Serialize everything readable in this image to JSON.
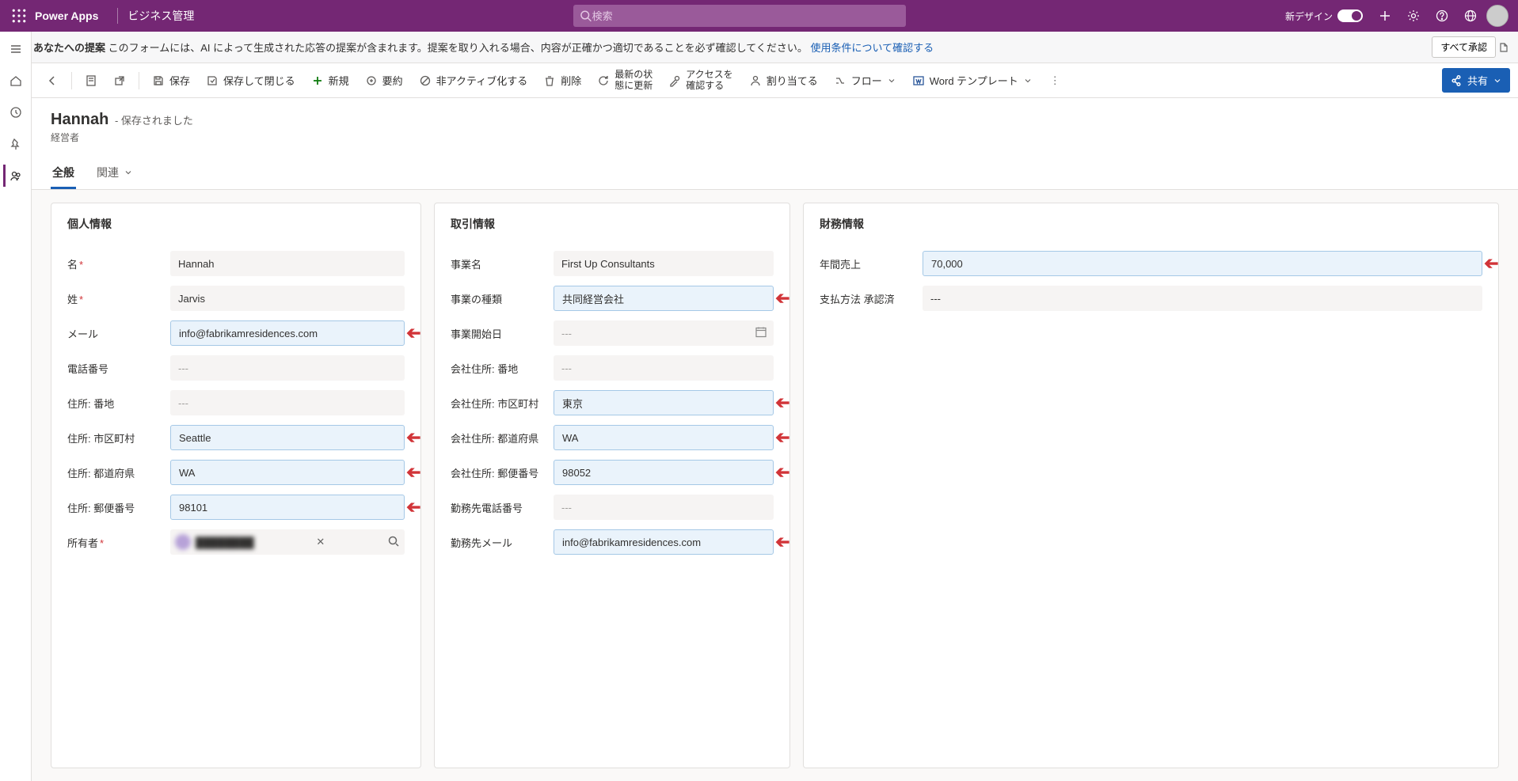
{
  "header": {
    "brand": "Power Apps",
    "app_name": "ビジネス管理",
    "search_placeholder": "検索",
    "new_design_label": "新デザイン"
  },
  "banner": {
    "prefix": "あなたへの提案",
    "text": "このフォームには、AI によって生成された応答の提案が含まれます。提案を取り入れる場合、内容が正確かつ適切であることを必ず確認してください。",
    "link": "使用条件について確認する",
    "approve_all": "すべて承認"
  },
  "commands": {
    "save": "保存",
    "save_close": "保存して閉じる",
    "new": "新規",
    "summary": "要約",
    "deactivate": "非アクティブ化する",
    "delete": "削除",
    "refresh_l1": "最新の状",
    "refresh_l2": "態に更新",
    "access_l1": "アクセスを",
    "access_l2": "確認する",
    "assign": "割り当てる",
    "flow": "フロー",
    "word_tpl": "Word テンプレート",
    "share": "共有"
  },
  "record": {
    "title": "Hannah",
    "status": "- 保存されました",
    "subtitle": "経営者",
    "tab_general": "全般",
    "tab_related": "関連"
  },
  "sections": {
    "personal": "個人情報",
    "business": "取引情報",
    "financial": "財務情報"
  },
  "fields": {
    "first_name_label": "名",
    "first_name": "Hannah",
    "last_name_label": "姓",
    "last_name": "Jarvis",
    "email_label": "メール",
    "email": "info@fabrikamresidences.com",
    "phone_label": "電話番号",
    "phone": "---",
    "addr_street_label": "住所: 番地",
    "addr_street": "---",
    "addr_city_label": "住所: 市区町村",
    "addr_city": "Seattle",
    "addr_state_label": "住所: 都道府県",
    "addr_state": "WA",
    "addr_zip_label": "住所: 郵便番号",
    "addr_zip": "98101",
    "owner_label": "所有者",
    "biz_name_label": "事業名",
    "biz_name": "First Up Consultants",
    "biz_type_label": "事業の種類",
    "biz_type": "共同経営会社",
    "biz_start_label": "事業開始日",
    "biz_start": "---",
    "co_addr_street_label": "会社住所: 番地",
    "co_addr_street": "---",
    "co_addr_city_label": "会社住所: 市区町村",
    "co_addr_city": "東京",
    "co_addr_state_label": "会社住所: 都道府県",
    "co_addr_state": "WA",
    "co_addr_zip_label": "会社住所: 郵便番号",
    "co_addr_zip": "98052",
    "work_phone_label": "勤務先電話番号",
    "work_phone": "---",
    "work_email_label": "勤務先メール",
    "work_email": "info@fabrikamresidences.com",
    "annual_rev_label": "年間売上",
    "annual_rev": "70,000",
    "pay_method_label": "支払方法 承認済",
    "pay_method": "---"
  }
}
